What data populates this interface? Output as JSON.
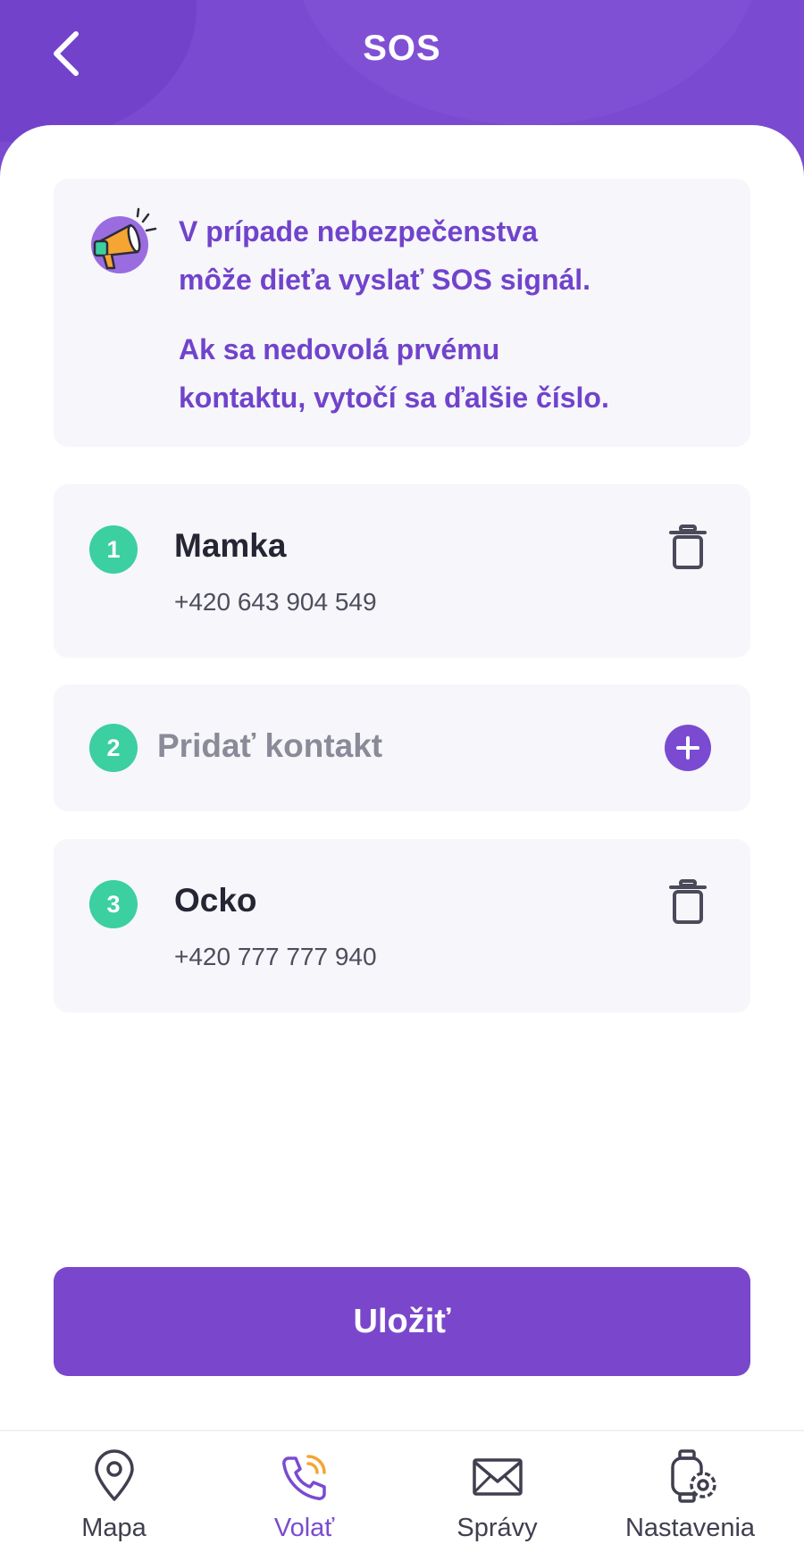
{
  "header": {
    "title": "SOS"
  },
  "info": {
    "line1": "V prípade nebezpečenstva",
    "line2": "môže dieťa vyslať SOS signál.",
    "line3": "Ak sa nedovolá prvému",
    "line4": "kontaktu, vytočí sa ďalšie číslo."
  },
  "contacts": [
    {
      "number": "1",
      "name": "Mamka",
      "phone": "+420 643 904 549"
    },
    {
      "number": "2",
      "add_label": "Pridať kontakt"
    },
    {
      "number": "3",
      "name": "Ocko",
      "phone": "+420 777 777 940"
    }
  ],
  "actions": {
    "save_label": "Uložiť"
  },
  "nav": {
    "items": [
      {
        "label": "Mapa",
        "icon": "map-pin-icon"
      },
      {
        "label": "Volať",
        "icon": "phone-call-icon",
        "active": true
      },
      {
        "label": "Správy",
        "icon": "envelope-icon"
      },
      {
        "label": "Nastavenia",
        "icon": "watch-settings-icon"
      }
    ]
  },
  "colors": {
    "primary": "#7a4bd0",
    "badge": "#3ccfa0",
    "card_bg": "#f6f6fb",
    "accent_orange": "#f4a532"
  }
}
